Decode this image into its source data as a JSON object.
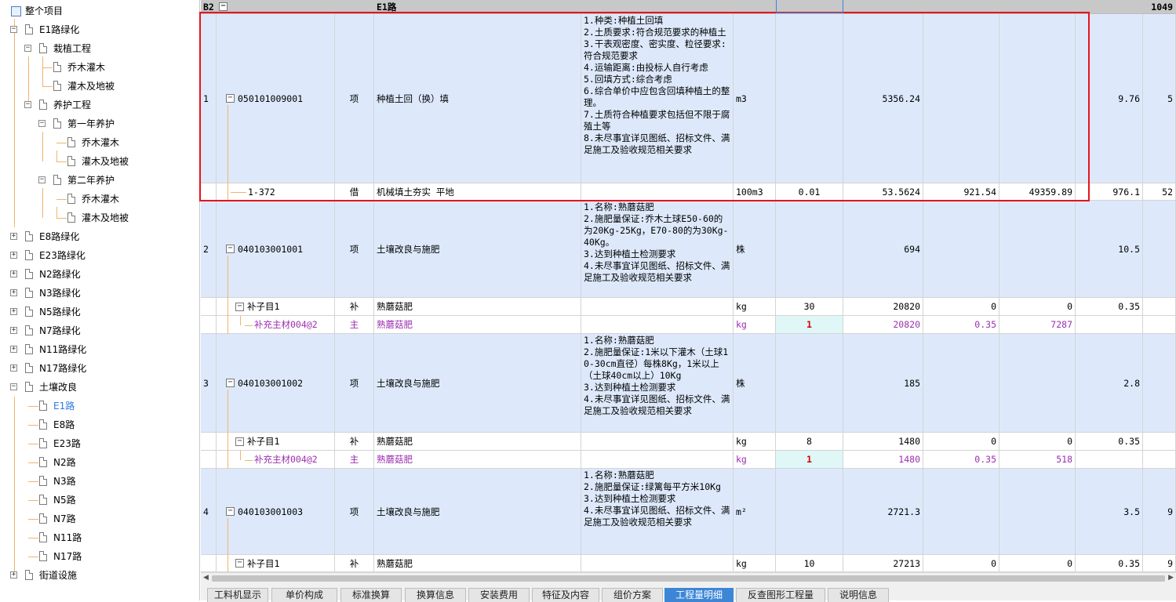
{
  "tree": {
    "root": "整个项目",
    "nodes": [
      {
        "label": "E1路绿化",
        "level": 1,
        "kind": "folder",
        "toggle": "−"
      },
      {
        "label": "栽植工程",
        "level": 2,
        "kind": "folder",
        "toggle": "−"
      },
      {
        "label": "乔木灌木",
        "level": 3,
        "kind": "leaf"
      },
      {
        "label": "灌木及地被",
        "level": 3,
        "kind": "leaf"
      },
      {
        "label": "养护工程",
        "level": 2,
        "kind": "folder",
        "toggle": "−"
      },
      {
        "label": "第一年养护",
        "level": 3,
        "kind": "folder",
        "toggle": "−"
      },
      {
        "label": "乔木灌木",
        "level": 4,
        "kind": "leaf"
      },
      {
        "label": "灌木及地被",
        "level": 4,
        "kind": "leaf"
      },
      {
        "label": "第二年养护",
        "level": 3,
        "kind": "folder",
        "toggle": "−"
      },
      {
        "label": "乔木灌木",
        "level": 4,
        "kind": "leaf"
      },
      {
        "label": "灌木及地被",
        "level": 4,
        "kind": "leaf"
      },
      {
        "label": "E8路绿化",
        "level": 1,
        "kind": "folder",
        "toggle": "+"
      },
      {
        "label": "E23路绿化",
        "level": 1,
        "kind": "folder",
        "toggle": "+"
      },
      {
        "label": "N2路绿化",
        "level": 1,
        "kind": "folder",
        "toggle": "+"
      },
      {
        "label": "N3路绿化",
        "level": 1,
        "kind": "folder",
        "toggle": "+"
      },
      {
        "label": "N5路绿化",
        "level": 1,
        "kind": "folder",
        "toggle": "+"
      },
      {
        "label": "N7路绿化",
        "level": 1,
        "kind": "folder",
        "toggle": "+"
      },
      {
        "label": "N11路绿化",
        "level": 1,
        "kind": "folder",
        "toggle": "+"
      },
      {
        "label": "N17路绿化",
        "level": 1,
        "kind": "folder",
        "toggle": "+"
      },
      {
        "label": "土壤改良",
        "level": 1,
        "kind": "folder",
        "toggle": "−"
      },
      {
        "label": "E1路",
        "level": 2,
        "kind": "leaf",
        "selected": true
      },
      {
        "label": "E8路",
        "level": 2,
        "kind": "leaf"
      },
      {
        "label": "E23路",
        "level": 2,
        "kind": "leaf"
      },
      {
        "label": "N2路",
        "level": 2,
        "kind": "leaf"
      },
      {
        "label": "N3路",
        "level": 2,
        "kind": "leaf"
      },
      {
        "label": "N5路",
        "level": 2,
        "kind": "leaf"
      },
      {
        "label": "N7路",
        "level": 2,
        "kind": "leaf"
      },
      {
        "label": "N11路",
        "level": 2,
        "kind": "leaf"
      },
      {
        "label": "N17路",
        "level": 2,
        "kind": "leaf"
      },
      {
        "label": "街道设施",
        "level": 1,
        "kind": "folder",
        "toggle": "+"
      }
    ]
  },
  "grid": {
    "header": {
      "seq": "B2",
      "toggle": "−",
      "name": "E1路",
      "total": "1049"
    },
    "rows": [
      {
        "type": "main",
        "seq": "1",
        "toggle": "−",
        "code": "050101009001",
        "kind": "项",
        "name": "种植土回（换）填",
        "spec": "1.种类:种植土回填\n2.土质要求:符合规范要求的种植土\n3.干表观密度、密实度、粒径要求:符合规范要求\n4.运输距离:由投标人自行考虑\n5.回填方式:综合考虑\n6.综合单价中应包含回填种植土的整理。\n7.土质符合种植要求包括但不限于腐殖土等\n8.未尽事宜详见图纸、招标文件、满足施工及验收规范相关要求",
        "unit": "m3",
        "factor": "",
        "qty": "5356.24",
        "price": "",
        "total": "",
        "unit_price": "9.76",
        "extra": "5"
      },
      {
        "type": "sub",
        "seq": "",
        "code": "1-372",
        "kind": "借",
        "name": "机械填土夯实 平地",
        "spec": "",
        "unit": "100m3",
        "factor": "0.01",
        "qty": "53.5624",
        "price": "921.54",
        "total": "49359.89",
        "unit_price": "976.1",
        "extra": "52"
      },
      {
        "type": "main",
        "seq": "2",
        "toggle": "−",
        "code": "040103001001",
        "kind": "项",
        "name": "土壤改良与施肥",
        "spec": "1.名称:熟蘑菇肥\n2.施肥量保证:乔木土球E50-60的为20Kg-25Kg，E70-80的为30Kg-40Kg。\n3.达到种植土检测要求\n4.未尽事宜详见图纸、招标文件、满足施工及验收规范相关要求",
        "unit": "株",
        "factor": "",
        "qty": "694",
        "price": "",
        "total": "",
        "unit_price": "10.5",
        "extra": ""
      },
      {
        "type": "sub",
        "toggle": "−",
        "seq": "",
        "code": "补子目1",
        "kind": "补",
        "name": "熟蘑菇肥",
        "spec": "",
        "unit": "kg",
        "factor": "30",
        "qty": "20820",
        "price": "0",
        "total": "0",
        "unit_price": "0.35",
        "extra": ""
      },
      {
        "type": "mat",
        "seq": "",
        "code": "补充主材004@2",
        "kind": "主",
        "name": "熟蘑菇肥",
        "spec": "",
        "unit": "kg",
        "factor": "1",
        "qty": "20820",
        "price": "0.35",
        "total": "7287",
        "unit_price": "",
        "extra": ""
      },
      {
        "type": "main",
        "seq": "3",
        "toggle": "−",
        "code": "040103001002",
        "kind": "项",
        "name": "土壤改良与施肥",
        "spec": "1.名称:熟蘑菇肥\n2.施肥量保证:1米以下灌木（土球10-30cm直径）每株8Kg，1米以上（土球40cm以上）10Kg\n3.达到种植土检测要求\n4.未尽事宜详见图纸、招标文件、满足施工及验收规范相关要求",
        "unit": "株",
        "factor": "",
        "qty": "185",
        "price": "",
        "total": "",
        "unit_price": "2.8",
        "extra": ""
      },
      {
        "type": "sub",
        "toggle": "−",
        "seq": "",
        "code": "补子目1",
        "kind": "补",
        "name": "熟蘑菇肥",
        "spec": "",
        "unit": "kg",
        "factor": "8",
        "qty": "1480",
        "price": "0",
        "total": "0",
        "unit_price": "0.35",
        "extra": ""
      },
      {
        "type": "mat",
        "seq": "",
        "code": "补充主材004@2",
        "kind": "主",
        "name": "熟蘑菇肥",
        "spec": "",
        "unit": "kg",
        "factor": "1",
        "qty": "1480",
        "price": "0.35",
        "total": "518",
        "unit_price": "",
        "extra": ""
      },
      {
        "type": "main",
        "seq": "4",
        "toggle": "−",
        "code": "040103001003",
        "kind": "项",
        "name": "土壤改良与施肥",
        "spec": "1.名称:熟蘑菇肥\n2.施肥量保证:绿篱每平方米10Kg\n3.达到种植土检测要求\n4.未尽事宜详见图纸、招标文件、满足施工及验收规范相关要求",
        "unit": "m²",
        "factor": "",
        "qty": "2721.3",
        "price": "",
        "total": "",
        "unit_price": "3.5",
        "extra": "9"
      },
      {
        "type": "sub",
        "toggle": "−",
        "seq": "",
        "code": "补子目1",
        "kind": "补",
        "name": "熟蘑菇肥",
        "spec": "",
        "unit": "kg",
        "factor": "10",
        "qty": "27213",
        "price": "0",
        "total": "0",
        "unit_price": "0.35",
        "extra": "9"
      }
    ]
  },
  "tabs": [
    {
      "label": "工料机显示"
    },
    {
      "label": "单价构成"
    },
    {
      "label": "标准换算"
    },
    {
      "label": "换算信息"
    },
    {
      "label": "安装费用"
    },
    {
      "label": "特征及内容"
    },
    {
      "label": "组价方案"
    },
    {
      "label": "工程量明细",
      "active": true
    },
    {
      "label": "反查图形工程量"
    },
    {
      "label": "说明信息"
    }
  ],
  "colors": {
    "highlight": "#e6141b",
    "main_row_bg": "#dde9fb",
    "material_text": "#9b2fae",
    "active_tab": "#3d86d6",
    "tree_line": "#f0b46c"
  }
}
